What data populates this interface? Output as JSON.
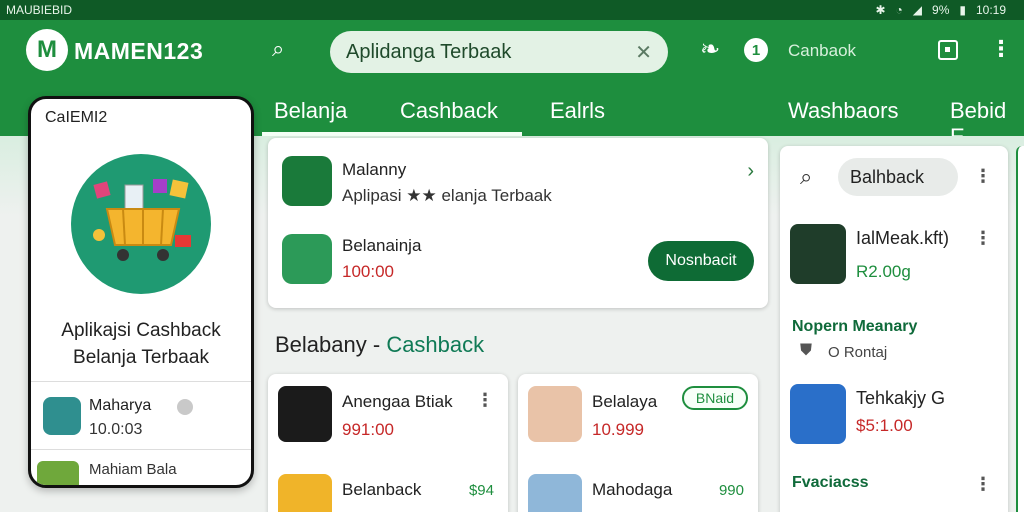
{
  "statusbar": {
    "left": "MAUBIEBID",
    "battery": "9%",
    "time": "10:19"
  },
  "appbar": {
    "logo": "M",
    "brand": "MAMEN123",
    "search_value": "Aplidanga Terbaak",
    "notif_count": "1",
    "cashback_label": "Canbaok"
  },
  "tabs": [
    "Belanja",
    "Cashback",
    "Ealrls",
    "Washbaors",
    "Bebid E"
  ],
  "phone": {
    "title": "CaIEMI2",
    "headline": "Aplikajsi Cashback Belanja Terbaak",
    "row1_name": "Maharya",
    "row1_value": "10.0:03",
    "row2_name": "Mahiam Bala"
  },
  "topcard": {
    "item1_name": "Malanny",
    "item1_sub": "Aplipasi ★★ elanja Terbaak",
    "item2_name": "Belanainja",
    "item2_price": "100:00",
    "button": "Nosnbacit"
  },
  "section": {
    "title": "Belabany",
    "dash": " - ",
    "accent": "Cashback"
  },
  "grid": [
    {
      "name": "Anengaa Btiak",
      "price": "991:00",
      "extra": ""
    },
    {
      "name": "Belalaya",
      "price": "10.999",
      "extra": "BNaid"
    },
    {
      "name": "Belanback",
      "price": "",
      "extra": "$94"
    },
    {
      "name": "Mahodaga",
      "price": "",
      "extra": "990"
    }
  ],
  "right_panel": {
    "chip": "Balhback",
    "item1_name": "IalMeak.kft)",
    "item1_price": "R2.00g",
    "section1": "Nopern Meanary",
    "rating": "O Rontaj",
    "item2_name": "Tehkakjy G",
    "item2_price": "$5:1.00",
    "section2": "Fvaciacss"
  }
}
